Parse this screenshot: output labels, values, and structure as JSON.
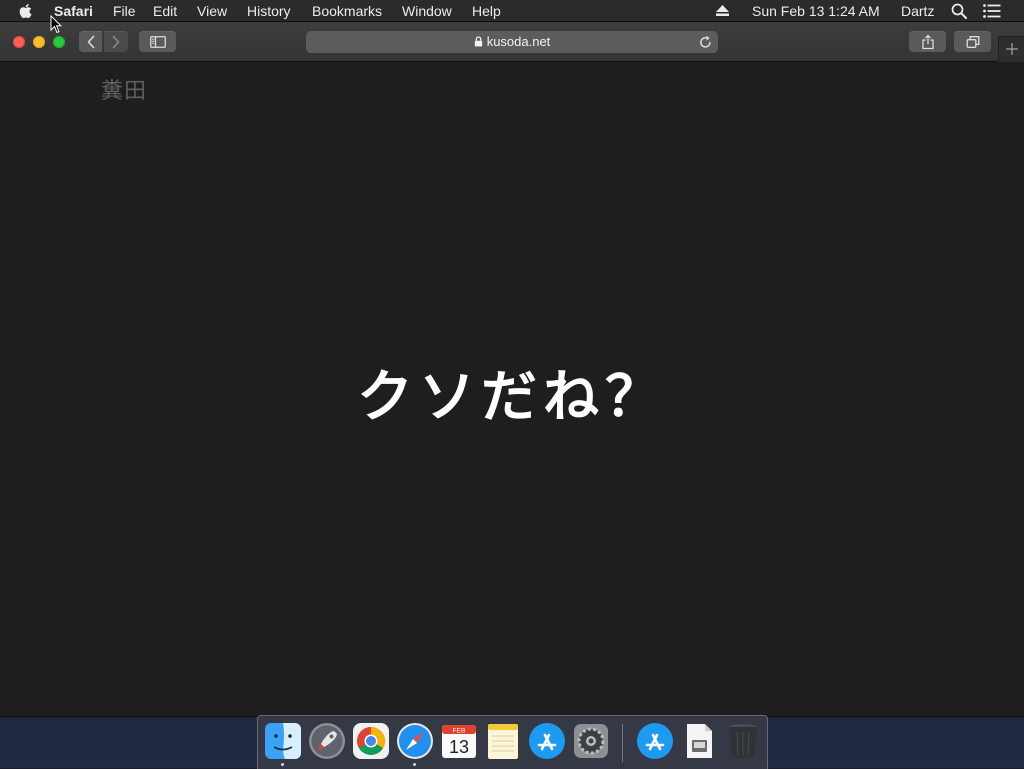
{
  "menubar": {
    "app_name": "Safari",
    "items": [
      "File",
      "Edit",
      "View",
      "History",
      "Bookmarks",
      "Window",
      "Help"
    ],
    "clock": "Sun Feb 13  1:24 AM",
    "user": "Dartz"
  },
  "toolbar": {
    "url": "kusoda.net"
  },
  "page": {
    "logo_text": "糞田",
    "headline": "クソだね？"
  },
  "dock": {
    "apps": [
      "finder",
      "launchpad",
      "google-chrome",
      "safari",
      "calendar",
      "notes",
      "app-store",
      "system-preferences",
      "app-store",
      "document",
      "trash"
    ],
    "calendar": {
      "month": "FEB",
      "day": "13"
    }
  },
  "colors": {
    "close": "#fe5f57",
    "minimize": "#febc2e",
    "zoom": "#28c840",
    "page_background": "#1e1e1e",
    "headline": "#ffffff",
    "logo": "#5f5f5f"
  }
}
